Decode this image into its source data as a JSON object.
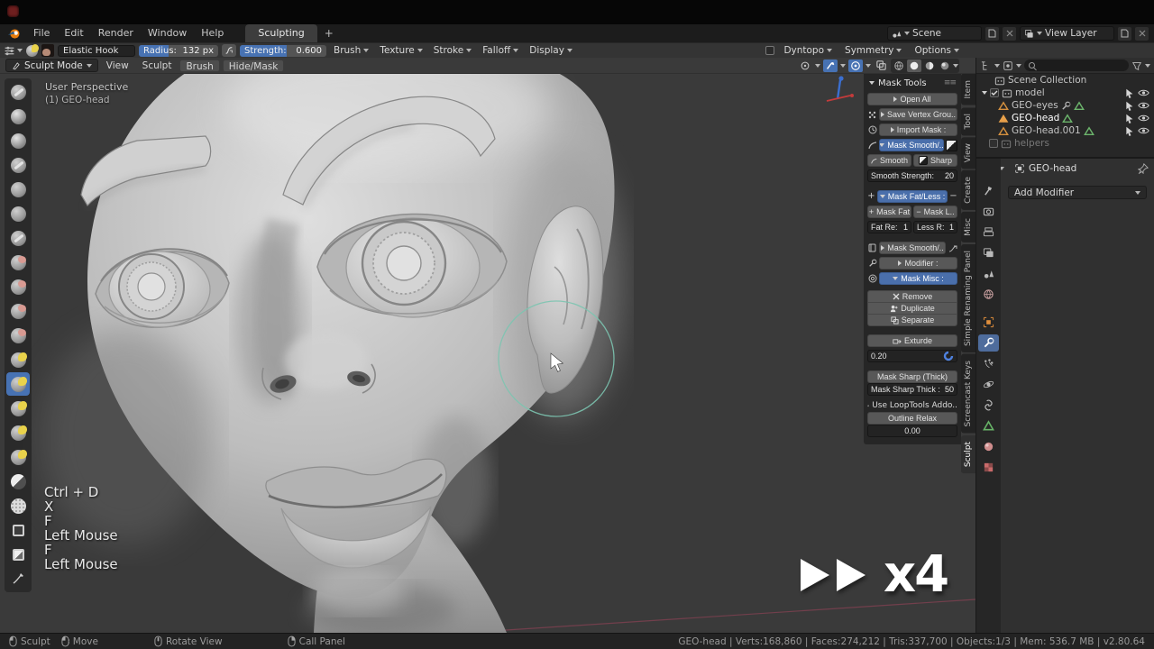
{
  "topbar": {
    "menus": [
      "File",
      "Edit",
      "Render",
      "Window",
      "Help"
    ],
    "workspace_tab": "Sculpting",
    "new_tab": "+",
    "scene_label": "Scene",
    "view_layer_label": "View Layer"
  },
  "tool_header": {
    "brush_name": "Elastic Hook",
    "radius_label": "Radius:",
    "radius_value": "132 px",
    "strength_label": "Strength:",
    "strength_value": "0.600",
    "menus": [
      "Brush",
      "Texture",
      "Stroke",
      "Falloff",
      "Display"
    ],
    "right_menus": [
      "Dyntopo",
      "Symmetry",
      "Options"
    ]
  },
  "viewport_header": {
    "mode": "Sculpt Mode",
    "menus": [
      "View",
      "Sculpt",
      "Brush",
      "Hide/Mask"
    ]
  },
  "toolbar": {
    "active_index": 12,
    "tools": [
      "draw",
      "clay",
      "clay-strips",
      "layer",
      "inflate",
      "blob",
      "crease",
      "smooth",
      "flatten",
      "scrape",
      "pinch",
      "grab",
      "elastic-hook",
      "thumb",
      "pose",
      "nudge",
      "mask",
      "simplify",
      "box-hide",
      "box-mask",
      "annotate"
    ]
  },
  "viewport": {
    "overlay_line1": "User Perspective",
    "overlay_line2": "(1) GEO-head",
    "keycast": [
      "Ctrl + D",
      "X",
      "F",
      "Left Mouse",
      "F",
      "Left Mouse"
    ],
    "speed_multiplier": "x4",
    "cursor_color": "#7cc4b0"
  },
  "npanel": {
    "title": "Mask Tools",
    "open_all": "Open All",
    "save_vertex_groups": "Save Vertex Grou..",
    "import_mask": "Import Mask :",
    "mask_smooth_sharp": "Mask Smooth/..",
    "smooth": "Smooth",
    "sharp": "Sharp",
    "smooth_strength_label": "Smooth Strength:",
    "smooth_strength_value": "20",
    "mask_fat_less": "Mask Fat/Less :",
    "plus": "+",
    "minus": "−",
    "mask_fat": "Mask Fat",
    "mask_less": "Mask L..",
    "fat_label": "Fat Re:",
    "fat_value": "1",
    "less_label": "Less R:",
    "less_value": "1",
    "mask_smooth_2": "Mask Smooth/..",
    "modifier": "Modifier :",
    "mask_misc": "Mask Misc :",
    "remove": "Remove",
    "duplicate": "Duplicate",
    "separate": "Separate",
    "exturde": "Exturde",
    "exturde_value": "0.20",
    "mask_sharp_thick_button": "Mask Sharp (Thick)",
    "mask_sharp_thick_label": "Mask Sharp Thick :",
    "mask_sharp_thick_value": "50",
    "looptools_warning": "Use LoopTools Addo..",
    "outline_relax": "Outline Relax",
    "outline_relax_value": "0.00",
    "tabs": [
      "Item",
      "Tool",
      "View",
      "Create",
      "Misc",
      "Simple Renaming Panel",
      "Screencast Keys",
      "Sculpt"
    ],
    "active_tab": "Sculpt"
  },
  "outliner": {
    "rows": [
      {
        "label": "Scene Collection"
      },
      {
        "label": "model"
      },
      {
        "label": "GEO-eyes"
      },
      {
        "label": "GEO-head"
      },
      {
        "label": "GEO-head.001"
      },
      {
        "label": "helpers"
      }
    ]
  },
  "properties": {
    "breadcrumb_object": "GEO-head",
    "add_modifier_label": "Add Modifier",
    "active_tab": "modifiers",
    "tabs": [
      "active-tool",
      "render",
      "output",
      "view-layer",
      "scene",
      "world",
      "object",
      "modifiers",
      "particles",
      "physics",
      "constraints",
      "object-data",
      "material",
      "texture"
    ]
  },
  "statusbar": {
    "hints": [
      {
        "button": "left-mouse",
        "label": "Sculpt"
      },
      {
        "button": "left-mouse-drag",
        "label": "Move"
      },
      {
        "button": "middle-mouse",
        "label": "Rotate View"
      },
      {
        "button": "right-mouse",
        "label": "Call Panel"
      }
    ],
    "stats": "GEO-head | Verts:168,860 | Faces:274,212 | Tris:337,700 | Objects:1/3 | Mem: 536.7 MB | v2.80.64"
  },
  "colors": {
    "accent_blue": "#4772b3",
    "object_orange": "#e08e3c",
    "mesh_green": "#67b367",
    "cursor_teal": "#7cc4b0"
  }
}
